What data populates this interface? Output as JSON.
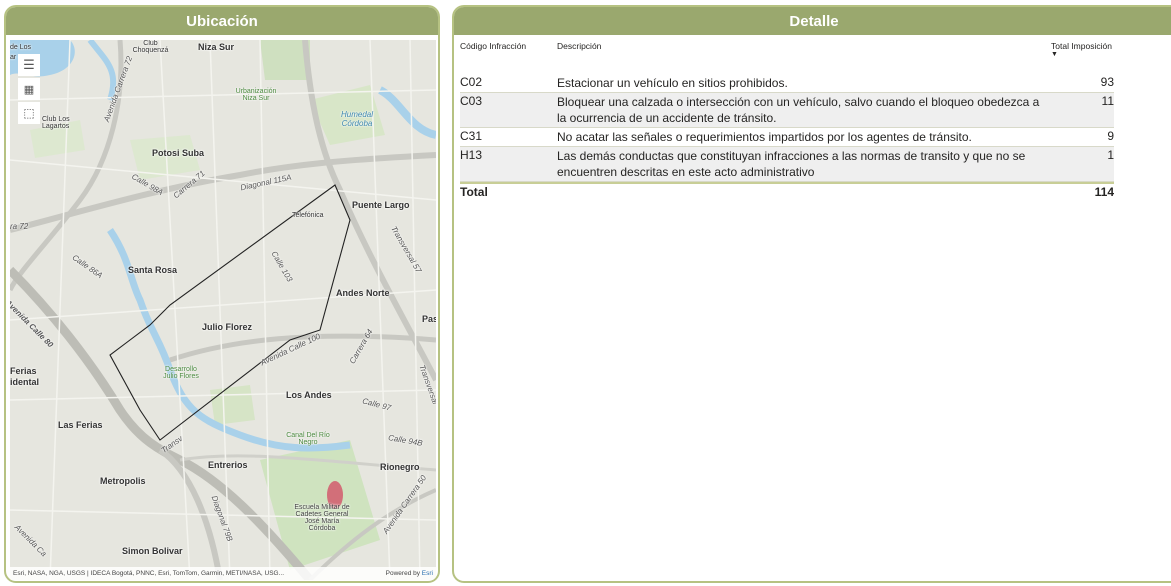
{
  "map_panel": {
    "title": "Ubicación",
    "attribution": "Esri, NASA, NGA, USGS | IDECA Bogotá, PNNC, Esri, TomTom, Garmin, METI/NASA, USG...",
    "powered_by": "Powered by",
    "powered_brand": "Esri",
    "labels": {
      "club_choquenza": "Club Choquenzá",
      "niza_sur": "Niza Sur",
      "urbanizacion_niza_sur": "Urbanización Niza Sur",
      "humedal_cordoba": "Humedal Córdoba",
      "club_los_lagartos": "Club Los Lagartos",
      "potosi_suba": "Potosi Suba",
      "av_carrera_72": "Avenida Carrera 72",
      "calle_98a": "Calle 98A",
      "carrera_71": "Carrera 71",
      "diagonal_115a": "Diagonal 115A",
      "telefonica": "Telefónica",
      "puente_largo": "Puente Largo",
      "ra_72": "ra 72",
      "calle_86a": "Calle 86A",
      "santa_rosa": "Santa Rosa",
      "calle_103": "Calle 103",
      "transversal_57": "Transversal 57",
      "andes_norte": "Andes Norte",
      "avenida_calle_80": "Avenida Calle 80",
      "julio_florez": "Julio Florez",
      "pas": "Pas",
      "avenida_calle_100": "Avenida Calle 100",
      "carrera_64": "Carrera 64",
      "ferias": "Ferias",
      "idental": "idental",
      "desarrollo_julio_flores": "Desarrollo Julio Flores",
      "los_andes": "Los Andes",
      "calle_97": "Calle 97",
      "transversal": "Transversal",
      "las_ferias": "Las Ferias",
      "canal_rio_negro": "Canal Del Río Negro",
      "calle_94b": "Calle 94B",
      "entrerios": "Entrerios",
      "rionegro": "Rionegro",
      "metropolis": "Metropolis",
      "transv": "Transv",
      "av_carrera_50": "Avenida Carrera 50",
      "escuela_militar": "Escuela Militar de Cadetes General José María Córdoba",
      "diagonal_79b": "Diagonal 79B",
      "simon_bolivar": "Simon Bolivar",
      "avenida_ca": "Avenida Ca",
      "de_los": "de Los",
      "ar": "ar"
    }
  },
  "detail_panel": {
    "title": "Detalle",
    "columns": {
      "code": "Código Infracción",
      "description": "Descripción",
      "total": "Total Imposición"
    },
    "rows": [
      {
        "code": "C02",
        "description": "Estacionar un vehículo en sitios prohibidos.",
        "total": "93"
      },
      {
        "code": "C03",
        "description": "Bloquear una calzada o intersección con un vehículo, salvo cuando el bloqueo obedezca a la ocurrencia de un accidente de tránsito.",
        "total": "11"
      },
      {
        "code": "C31",
        "description": "No acatar las señales o requerimientos impartidos por los agentes de tránsito.",
        "total": "9"
      },
      {
        "code": "H13",
        "description": "Las demás conductas que constituyan infracciones a las normas de transito y que no se encuentren descritas en este acto administrativo",
        "total": "1"
      }
    ],
    "total_label": "Total",
    "total_value": "114"
  }
}
